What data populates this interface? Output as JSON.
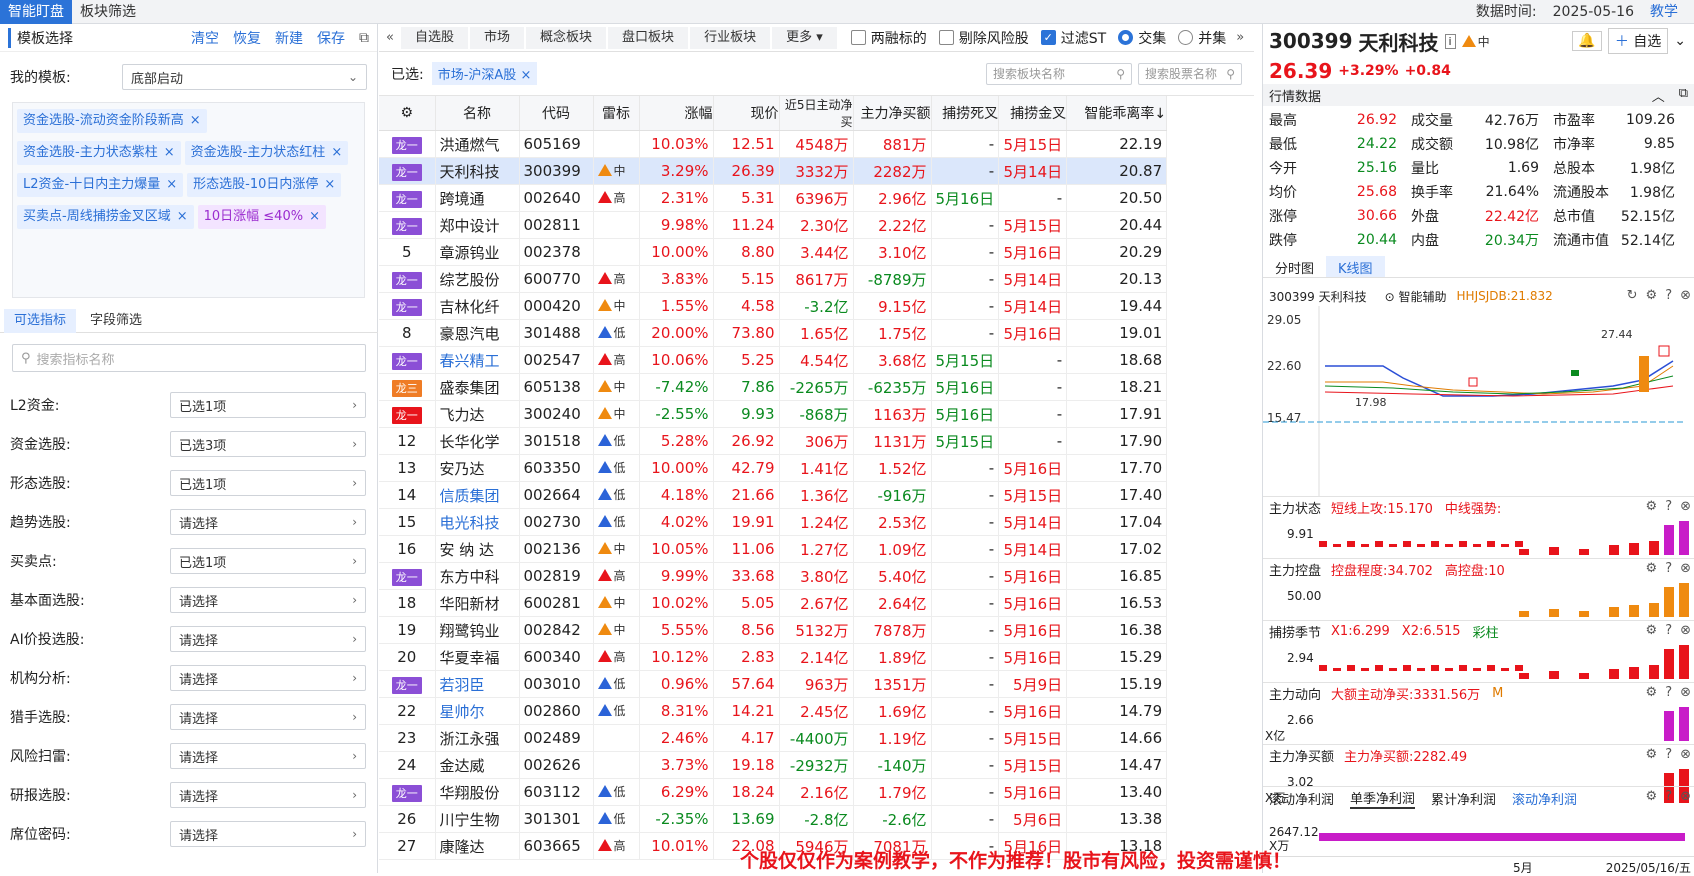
{
  "topbar": {
    "tabs": [
      "智能盯盘",
      "板块筛选"
    ],
    "data_time_label": "数据时间:",
    "data_time": "2025-05-16",
    "teach": "教学"
  },
  "left": {
    "title": "模板选择",
    "actions": [
      "清空",
      "恢复",
      "新建",
      "保存"
    ],
    "my_template_label": "我的模板:",
    "my_template_value": "底部启动",
    "tags": [
      {
        "text": "资金选股-流动资金阶段新高",
        "purple": false
      },
      {
        "text": "资金选股-主力状态紫柱",
        "purple": false
      },
      {
        "text": "资金选股-主力状态红柱",
        "purple": false
      },
      {
        "text": "L2资金-十日内主力爆量",
        "purple": false
      },
      {
        "text": "形态选股-10日内涨停",
        "purple": false
      },
      {
        "text": "买卖点-周线捕捞金叉区域",
        "purple": false
      },
      {
        "text": "10日涨幅 ≤40%",
        "purple": true
      }
    ],
    "subtabs": [
      "可选指标",
      "字段筛选"
    ],
    "search_placeholder": "搜索指标名称",
    "filters": [
      {
        "label": "L2资金:",
        "value": "已选1项"
      },
      {
        "label": "资金选股:",
        "value": "已选3项"
      },
      {
        "label": "形态选股:",
        "value": "已选1项"
      },
      {
        "label": "趋势选股:",
        "value": "请选择"
      },
      {
        "label": "买卖点:",
        "value": "已选1项"
      },
      {
        "label": "基本面选股:",
        "value": "请选择"
      },
      {
        "label": "AI价投选股:",
        "value": "请选择"
      },
      {
        "label": "机构分析:",
        "value": "请选择"
      },
      {
        "label": "猎手选股:",
        "value": "请选择"
      },
      {
        "label": "风险扫雷:",
        "value": "请选择"
      },
      {
        "label": "研报选股:",
        "value": "请选择"
      },
      {
        "label": "席位密码:",
        "value": "请选择"
      }
    ]
  },
  "mid": {
    "tabs": [
      "自选股",
      "市场",
      "概念板块",
      "盘口板块",
      "行业板块",
      "更多"
    ],
    "checks": [
      {
        "label": "两融标的",
        "on": false
      },
      {
        "label": "剔除风险股",
        "on": false
      },
      {
        "label": "过滤ST",
        "on": true
      }
    ],
    "radios": [
      {
        "label": "交集",
        "on": true
      },
      {
        "label": "并集",
        "on": false
      }
    ],
    "chosen_label": "已选:",
    "chosen": "市场-沪深A股",
    "search_block": "搜索板块名称",
    "search_stock": "搜索股票名称",
    "headers": [
      "名称",
      "代码",
      "雷标",
      "涨幅",
      "现价",
      "近5日主动净买",
      "主力净买额",
      "捕捞死叉",
      "捕捞金叉",
      "智能乖离率↓"
    ],
    "rows": [
      [
        "龙一",
        "洪通燃气",
        "605169",
        "",
        "",
        "10.03%",
        "12.51",
        "4548万",
        "881万",
        "-",
        "5月15日",
        "22.19"
      ],
      [
        "龙一",
        "天利科技",
        "300399",
        "o",
        "中",
        "3.29%",
        "26.39",
        "3332万",
        "2282万",
        "-",
        "5月14日",
        "20.87"
      ],
      [
        "龙一",
        "跨境通",
        "002640",
        "r",
        "高",
        "2.31%",
        "5.31",
        "6396万",
        "2.96亿",
        "5月16日",
        "-",
        "20.50"
      ],
      [
        "龙一",
        "郑中设计",
        "002811",
        "",
        "",
        "9.98%",
        "11.24",
        "2.30亿",
        "2.22亿",
        "-",
        "5月15日",
        "20.44"
      ],
      [
        "5",
        "章源钨业",
        "002378",
        "",
        "",
        "10.00%",
        "8.80",
        "3.44亿",
        "3.10亿",
        "-",
        "5月16日",
        "20.29"
      ],
      [
        "龙一",
        "综艺股份",
        "600770",
        "r",
        "高",
        "3.83%",
        "5.15",
        "8617万",
        "-8789万",
        "-",
        "5月14日",
        "20.13"
      ],
      [
        "龙一",
        "吉林化纤",
        "000420",
        "o",
        "中",
        "1.55%",
        "4.58",
        "-3.2亿",
        "9.15亿",
        "-",
        "5月14日",
        "19.44"
      ],
      [
        "8",
        "豪恩汽电",
        "301488",
        "b",
        "低",
        "20.00%",
        "73.80",
        "1.65亿",
        "1.75亿",
        "-",
        "5月16日",
        "19.01"
      ],
      [
        "龙一",
        "春兴精工",
        "002547",
        "r",
        "高",
        "10.06%",
        "5.25",
        "4.54亿",
        "3.68亿",
        "5月15日",
        "-",
        "18.68"
      ],
      [
        "龙三",
        "盛泰集团",
        "605138",
        "o",
        "中",
        "-7.42%",
        "7.86",
        "-2265万",
        "-6235万",
        "5月16日",
        "-",
        "18.21"
      ],
      [
        "龙一",
        "飞力达",
        "300240",
        "o",
        "中",
        "-2.55%",
        "9.93",
        "-868万",
        "1163万",
        "5月16日",
        "-",
        "17.91"
      ],
      [
        "12",
        "长华化学",
        "301518",
        "b",
        "低",
        "5.28%",
        "26.92",
        "306万",
        "1131万",
        "5月15日",
        "-",
        "17.90"
      ],
      [
        "13",
        "安乃达",
        "603350",
        "b",
        "低",
        "10.00%",
        "42.79",
        "1.41亿",
        "1.52亿",
        "-",
        "5月16日",
        "17.70"
      ],
      [
        "14",
        "信质集团",
        "002664",
        "b",
        "低",
        "4.18%",
        "21.66",
        "1.36亿",
        "-916万",
        "-",
        "5月15日",
        "17.40"
      ],
      [
        "15",
        "电光科技",
        "002730",
        "b",
        "低",
        "4.02%",
        "19.91",
        "1.24亿",
        "2.53亿",
        "-",
        "5月14日",
        "17.04"
      ],
      [
        "16",
        "安 纳 达",
        "002136",
        "o",
        "中",
        "10.05%",
        "11.06",
        "1.27亿",
        "1.09亿",
        "-",
        "5月14日",
        "17.02"
      ],
      [
        "龙一",
        "东方中科",
        "002819",
        "r",
        "高",
        "9.99%",
        "33.68",
        "3.80亿",
        "5.40亿",
        "-",
        "5月16日",
        "16.85"
      ],
      [
        "18",
        "华阳新材",
        "600281",
        "o",
        "中",
        "10.02%",
        "5.05",
        "2.67亿",
        "2.64亿",
        "-",
        "5月16日",
        "16.53"
      ],
      [
        "19",
        "翔鹭钨业",
        "002842",
        "o",
        "中",
        "5.55%",
        "8.56",
        "5132万",
        "7878万",
        "-",
        "5月16日",
        "16.38"
      ],
      [
        "20",
        "华夏幸福",
        "600340",
        "r",
        "高",
        "10.12%",
        "2.83",
        "2.14亿",
        "1.89亿",
        "-",
        "5月16日",
        "15.29"
      ],
      [
        "龙一",
        "若羽臣",
        "003010",
        "b",
        "低",
        "0.96%",
        "57.64",
        "963万",
        "1351万",
        "-",
        "5月9日",
        "15.19"
      ],
      [
        "22",
        "星帅尔",
        "002860",
        "b",
        "低",
        "8.31%",
        "14.21",
        "2.45亿",
        "1.69亿",
        "-",
        "5月16日",
        "14.79"
      ],
      [
        "23",
        "浙江永强",
        "002489",
        "",
        "",
        "2.46%",
        "4.17",
        "-4400万",
        "1.19亿",
        "-",
        "5月15日",
        "14.66"
      ],
      [
        "24",
        "金达威",
        "002626",
        "",
        "",
        "3.73%",
        "19.18",
        "-2932万",
        "-140万",
        "-",
        "5月15日",
        "14.47"
      ],
      [
        "龙一",
        "华翔股份",
        "603112",
        "b",
        "低",
        "6.29%",
        "18.24",
        "2.16亿",
        "1.79亿",
        "-",
        "5月16日",
        "13.40"
      ],
      [
        "26",
        "川宁生物",
        "301301",
        "b",
        "低",
        "-2.35%",
        "13.69",
        "-2.8亿",
        "-2.6亿",
        "-",
        "5月6日",
        "13.38"
      ],
      [
        "27",
        "康隆达",
        "603665",
        "r",
        "高",
        "10.01%",
        "22.08",
        "5946万",
        "7081万",
        "-",
        "5月16日",
        "13.18"
      ]
    ]
  },
  "right": {
    "code": "300399",
    "name": "天利科技",
    "risk": "中",
    "price": "26.39",
    "pct": "+3.29%",
    "chg": "+0.84",
    "watch": "自选",
    "quote_title": "行情数据",
    "quote": [
      [
        [
          "最高",
          "26.92",
          "r"
        ],
        [
          "成交量",
          "42.76万",
          ""
        ],
        [
          "市盈率",
          "109.26",
          ""
        ]
      ],
      [
        [
          "最低",
          "24.22",
          "g"
        ],
        [
          "成交额",
          "10.98亿",
          ""
        ],
        [
          "市净率",
          "9.85",
          ""
        ]
      ],
      [
        [
          "今开",
          "25.16",
          "g"
        ],
        [
          "量比",
          "1.69",
          ""
        ],
        [
          "总股本",
          "1.98亿",
          ""
        ]
      ],
      [
        [
          "均价",
          "25.68",
          "r"
        ],
        [
          "换手率",
          "21.64%",
          ""
        ],
        [
          "流通股本",
          "1.98亿",
          ""
        ]
      ],
      [
        [
          "涨停",
          "30.66",
          "r"
        ],
        [
          "外盘",
          "22.42亿",
          "r"
        ],
        [
          "总市值",
          "52.15亿",
          ""
        ]
      ],
      [
        [
          "跌停",
          "20.44",
          "g"
        ],
        [
          "内盘",
          "20.34万",
          "g"
        ],
        [
          "流通市值",
          "52.14亿",
          ""
        ]
      ]
    ],
    "chart_tabs": [
      "分时图",
      "K线图"
    ],
    "kline": {
      "stock": "300399 天利科技",
      "assist": "智能辅助",
      "hhjs": "HHJSJDB:21.832",
      "y_top": "29.05",
      "y_mid": "22.60",
      "y_bot": "15.47",
      "low_label": "17.98",
      "high_label": "27.44"
    },
    "panels": [
      {
        "name": "主力状态",
        "a": "短线上攻:15.170",
        "b": "中线强势:",
        "y": "9.91"
      },
      {
        "name": "主力控盘",
        "a": "控盘程度:34.702",
        "b": "高控盘:10",
        "y": "50.00"
      },
      {
        "name": "捕捞季节",
        "a": "X1:6.299",
        "b": "X2:6.515",
        "c": "彩柱",
        "y": "2.94"
      },
      {
        "name": "主力动向",
        "a": "大额主动净买:3331.56万",
        "b": "M",
        "y": "2.66",
        "unit": "X亿"
      },
      {
        "name": "主力净买额",
        "a": "主力净买额:2282.49",
        "y": "3.02",
        "unit": "X万"
      }
    ],
    "profit_tabs": [
      "滚动净利润",
      "单季净利润",
      "累计净利润",
      "滚动净利润"
    ],
    "profit_y": "2647.12",
    "profit_unit": "X万",
    "date_month": "5月",
    "date_end": "2025/05/16/五"
  },
  "disclaimer": "个股仅仅作为案例教学，不作为推荐！股市有风险，投资需谨慎！",
  "colors": {
    "accent": "#2b73d8",
    "up": "#e8141b",
    "down": "#0a8a1f",
    "badge_purple": "#8b4fd6"
  }
}
